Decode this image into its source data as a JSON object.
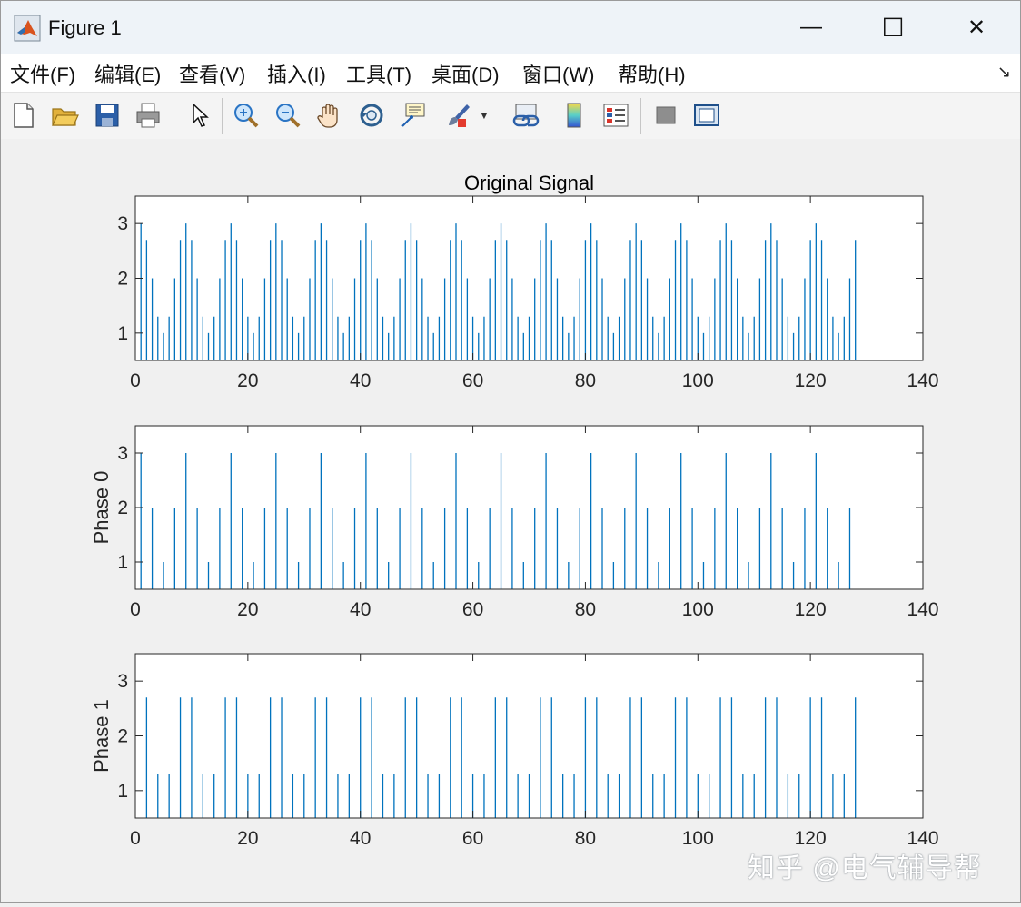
{
  "window": {
    "title": "Figure 1",
    "minimize_glyph": "—",
    "maximize_glyph": "☐",
    "close_glyph": "✕"
  },
  "menu": {
    "items": [
      {
        "label": "文件(F)",
        "name": "menu-file"
      },
      {
        "label": "编辑(E)",
        "name": "menu-edit"
      },
      {
        "label": "查看(V)",
        "name": "menu-view"
      },
      {
        "label": "插入(I)",
        "name": "menu-insert"
      },
      {
        "label": "工具(T)",
        "name": "menu-tools"
      },
      {
        "label": "桌面(D)",
        "name": "menu-desktop"
      },
      {
        "label": "窗口(W)",
        "name": "menu-window"
      },
      {
        "label": "帮助(H)",
        "name": "menu-help"
      }
    ],
    "dock_glyph": "↘"
  },
  "toolbar": {
    "icons": [
      "new-file-icon",
      "open-folder-icon",
      "save-icon",
      "print-icon",
      "pointer-icon",
      "zoom-in-icon",
      "zoom-out-icon",
      "pan-hand-icon",
      "rotate-3d-icon",
      "data-cursor-icon",
      "brush-icon",
      "dropdown-arrow-icon",
      "link-plot-icon",
      "colorbar-icon",
      "legend-icon",
      "hide-plot-tools-icon",
      "show-plot-tools-icon"
    ]
  },
  "colors": {
    "stem": "#0072BD",
    "axes_text": "#262626",
    "axes_box": "#262626"
  },
  "watermark": "知乎 @电气辅导帮",
  "chart_data": [
    {
      "type": "stem",
      "title": "Original Signal",
      "ylabel": "",
      "xlim": [
        0,
        140
      ],
      "ylim": [
        0.5,
        3.5
      ],
      "xticks": [
        "0",
        "20",
        "40",
        "60",
        "80",
        "100",
        "120",
        "140"
      ],
      "yticks": [
        "1",
        "2",
        "3"
      ],
      "x_start": 1,
      "x_step": 1,
      "values": [
        3,
        2.7,
        2,
        1.3,
        1,
        1.3,
        2,
        2.7,
        3,
        2.7,
        2,
        1.3,
        1,
        1.3,
        2,
        2.7,
        3,
        2.7,
        2,
        1.3,
        1,
        1.3,
        2,
        2.7,
        3,
        2.7,
        2,
        1.3,
        1,
        1.3,
        2,
        2.7,
        3,
        2.7,
        2,
        1.3,
        1,
        1.3,
        2,
        2.7,
        3,
        2.7,
        2,
        1.3,
        1,
        1.3,
        2,
        2.7,
        3,
        2.7,
        2,
        1.3,
        1,
        1.3,
        2,
        2.7,
        3,
        2.7,
        2,
        1.3,
        1,
        1.3,
        2,
        2.7,
        3,
        2.7,
        2,
        1.3,
        1,
        1.3,
        2,
        2.7,
        3,
        2.7,
        2,
        1.3,
        1,
        1.3,
        2,
        2.7,
        3,
        2.7,
        2,
        1.3,
        1,
        1.3,
        2,
        2.7,
        3,
        2.7,
        2,
        1.3,
        1,
        1.3,
        2,
        2.7,
        3,
        2.7,
        2,
        1.3,
        1,
        1.3,
        2,
        2.7,
        3,
        2.7,
        2,
        1.3,
        1,
        1.3,
        2,
        2.7,
        3,
        2.7,
        2,
        1.3,
        1,
        1.3,
        2,
        2.7,
        3,
        2.7,
        2,
        1.3,
        1,
        1.3,
        2,
        2.7
      ],
      "grid": false
    },
    {
      "type": "stem",
      "title": "",
      "ylabel": "Phase 0",
      "xlim": [
        0,
        140
      ],
      "ylim": [
        0.5,
        3.5
      ],
      "xticks": [
        "0",
        "20",
        "40",
        "60",
        "80",
        "100",
        "120",
        "140"
      ],
      "yticks": [
        "1",
        "2",
        "3"
      ],
      "x_start": 1,
      "x_step": 2,
      "values": [
        3,
        2,
        1,
        2,
        3,
        2,
        1,
        2,
        3,
        2,
        1,
        2,
        3,
        2,
        1,
        2,
        3,
        2,
        1,
        2,
        3,
        2,
        1,
        2,
        3,
        2,
        1,
        2,
        3,
        2,
        1,
        2,
        3,
        2,
        1,
        2,
        3,
        2,
        1,
        2,
        3,
        2,
        1,
        2,
        3,
        2,
        1,
        2,
        3,
        2,
        1,
        2,
        3,
        2,
        1,
        2,
        3,
        2,
        1,
        2,
        3,
        2,
        1,
        2
      ],
      "grid": false
    },
    {
      "type": "stem",
      "title": "",
      "ylabel": "Phase 1",
      "xlim": [
        0,
        140
      ],
      "ylim": [
        0.5,
        3.5
      ],
      "xticks": [
        "0",
        "20",
        "40",
        "60",
        "80",
        "100",
        "120",
        "140"
      ],
      "yticks": [
        "1",
        "2",
        "3"
      ],
      "x_start": 2,
      "x_step": 2,
      "values": [
        2.7,
        1.3,
        1.3,
        2.7,
        2.7,
        1.3,
        1.3,
        2.7,
        2.7,
        1.3,
        1.3,
        2.7,
        2.7,
        1.3,
        1.3,
        2.7,
        2.7,
        1.3,
        1.3,
        2.7,
        2.7,
        1.3,
        1.3,
        2.7,
        2.7,
        1.3,
        1.3,
        2.7,
        2.7,
        1.3,
        1.3,
        2.7,
        2.7,
        1.3,
        1.3,
        2.7,
        2.7,
        1.3,
        1.3,
        2.7,
        2.7,
        1.3,
        1.3,
        2.7,
        2.7,
        1.3,
        1.3,
        2.7,
        2.7,
        1.3,
        1.3,
        2.7,
        2.7,
        1.3,
        1.3,
        2.7,
        2.7,
        1.3,
        1.3,
        2.7,
        2.7,
        1.3,
        1.3,
        2.7
      ],
      "grid": false
    }
  ]
}
